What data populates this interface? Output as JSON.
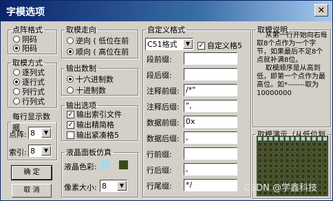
{
  "window": {
    "title": "字模选项",
    "close_icon": "close-icon"
  },
  "dot_format": {
    "legend": "点阵格式",
    "options": [
      "阴码",
      "阳码"
    ],
    "selected": 1
  },
  "scan_mode": {
    "legend": "取模方式",
    "options": [
      "逐列式",
      "逐行式",
      "列行式",
      "行列式"
    ],
    "selected": 1
  },
  "per_line": {
    "legend": "每行显示数据",
    "dot_label": "点阵:",
    "dot_value": "8",
    "index_label": "索引:",
    "index_value": "8"
  },
  "buttons": {
    "ok": "确 定",
    "cancel": "取 消"
  },
  "direction": {
    "legend": "取模走向",
    "options": [
      "逆向 ( 低位在前",
      "顺向 ( 高位在前"
    ],
    "selected": 1
  },
  "number_system": {
    "legend": "输出数制",
    "options": [
      "十六进制数",
      "十进制数"
    ],
    "selected": 0
  },
  "output_options": {
    "legend": "输出选项",
    "items": [
      {
        "label": "输出索引文件",
        "checked": true
      },
      {
        "label": "输出精简格",
        "checked": true
      },
      {
        "label": "输出紧凑格5",
        "checked": false
      }
    ]
  },
  "lcd": {
    "legend": "液晶面板仿真",
    "color_label": "液晶色彩:",
    "pixel_label": "像素大小:",
    "pixel_value": "8",
    "colors": {
      "light": "#a8d8e8",
      "dark": "#3a4a1a"
    }
  },
  "custom_format": {
    "legend": "自定义格式",
    "format_value": "C51格式",
    "custom_checkbox_label": "自定义格5",
    "custom_checked": true,
    "fields": [
      {
        "label": "段前缀:",
        "value": ""
      },
      {
        "label": "段后缀:",
        "value": ""
      },
      {
        "label": "注释前缀:",
        "value": "/*\""
      },
      {
        "label": "注释后缀:",
        "value": "\","
      },
      {
        "label": "数据前缀:",
        "value": "0x"
      },
      {
        "label": "数据后缀:",
        "value": ","
      },
      {
        "label": "行前缀:",
        "value": ""
      },
      {
        "label": "行后缀:",
        "value": ","
      },
      {
        "label": "行尾缀:",
        "value": "*/"
      }
    ]
  },
  "description": {
    "legend": "取模说明",
    "text": "    从第一行开始向右每取8个点作为一个字节，如果最后不足8个点就补满8位。\n    取模顺序是从高到低，即第一个点作为最高位。如*-------取为10000000"
  },
  "demo": {
    "legend": "取模演示（从低位到"
  },
  "watermark": "CSDN @学鑫科技"
}
